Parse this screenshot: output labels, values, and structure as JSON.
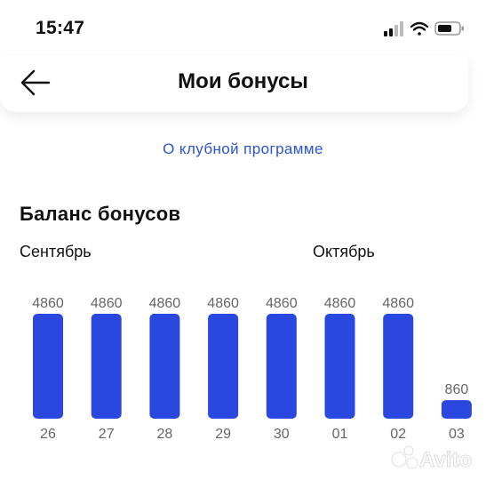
{
  "status": {
    "time": "15:47"
  },
  "header": {
    "title": "Мои бонусы"
  },
  "club_link": "О клубной программе",
  "section_title": "Баланс бонусов",
  "months": {
    "first": "Сентябрь",
    "second": "Октябрь"
  },
  "colors": {
    "bar": "#2a47e0",
    "link": "#2b54d6",
    "label": "#666666"
  },
  "watermark": {
    "text": "Avito"
  },
  "chart_data": {
    "type": "bar",
    "categories": [
      "26",
      "27",
      "28",
      "29",
      "30",
      "01",
      "02",
      "03"
    ],
    "values": [
      4860,
      4860,
      4860,
      4860,
      4860,
      4860,
      4860,
      860
    ],
    "title": "Баланс бонусов",
    "xlabel": "",
    "ylabel": "",
    "ylim": [
      0,
      4860
    ],
    "grid": false
  }
}
